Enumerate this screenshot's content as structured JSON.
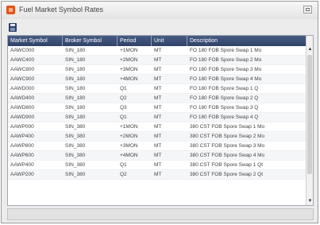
{
  "window": {
    "title": "Fuel Market Symbol Rates"
  },
  "toolbar": {
    "save_icon": "save-icon"
  },
  "grid": {
    "columns": [
      "Market Symbol",
      "Broker Symbol",
      "Period",
      "Unit",
      "Description"
    ],
    "rows": [
      [
        "AAWC000",
        "SIN_180",
        "+1MON",
        "MT",
        "FO 180 FOB Spore Swap 1 Mo"
      ],
      [
        "AAWC400",
        "SIN_180",
        "+2MON",
        "MT",
        "FO 180 FOB Spore Swap 2 Mo"
      ],
      [
        "AAWC800",
        "SIN_180",
        "+3MON",
        "MT",
        "FO 180 FOB Spore Swap 3 Mo"
      ],
      [
        "AAWC900",
        "SIN_180",
        "+4MON",
        "MT",
        "FO 180 FOB Spore Swap 4 Mo"
      ],
      [
        "AAWD000",
        "SIN_180",
        "Q1",
        "MT",
        "FO 180 FOB Spore Swap 1 Q"
      ],
      [
        "AAWD400",
        "SIN_180",
        "Q2",
        "MT",
        "FO 180 FOB Spore Swap 2 Q"
      ],
      [
        "AAWD800",
        "SIN_180",
        "Q3",
        "MT",
        "FO 180 FOB Spore Swap 3 Q"
      ],
      [
        "AAWD900",
        "SIN_180",
        "Q1",
        "MT",
        "FO 180 FOB Spore Swap 4 Q"
      ],
      [
        "AAWP000",
        "SIN_380",
        "+1MON",
        "MT",
        "380 CST FOB Spore Swap 1 Mo"
      ],
      [
        "AAWP400",
        "SIN_380",
        "+2MON",
        "MT",
        "380 CST FOB Spore Swap 2 Mo"
      ],
      [
        "AAWP800",
        "SIN_380",
        "+3MON",
        "MT",
        "380 CST FOB Spore Swap 3 Mo"
      ],
      [
        "AAWP600",
        "SIN_380",
        "+4MON",
        "MT",
        "380 CST FOB Spore Swap 4 Mo"
      ],
      [
        "AAWP400",
        "SIN_380",
        "Q1",
        "MT",
        "380 CST FOB Spore Swap 1 Qt"
      ],
      [
        "AAWP200",
        "SIN_380",
        "Q2",
        "MT",
        "380 CST FOB Spore Swap 2 Qt"
      ]
    ]
  }
}
